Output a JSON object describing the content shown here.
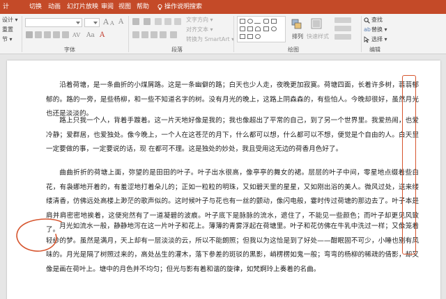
{
  "ribbon": {
    "tabs": [
      "计",
      "切换",
      "动画",
      "幻灯片放映",
      "审阅",
      "视图",
      "帮助"
    ],
    "tell_me": "操作说明搜索",
    "clipboard_items": [
      "设计 ▾",
      "重置",
      "节 ▾"
    ],
    "groups": {
      "font": "字体",
      "paragraph": "段落",
      "drawing": "绘图",
      "editing": "编辑"
    },
    "paragraph_items": [
      "文字方向 ▾",
      "对齐文本 ▾",
      "转换为 SmartArt ▾"
    ],
    "drawing_items": [
      "排列",
      "快速样式"
    ],
    "editing_items": [
      "查找",
      "替换 ▾",
      "选择 ▾"
    ],
    "glyphs": {
      "font_size_up": "A",
      "font_size_down": "A",
      "clear_format": "A",
      "char_spacing": "AV",
      "text_color": "A",
      "case": "Aa"
    }
  },
  "document": {
    "paragraphs": [
      "沿着荷塘，是一条曲折的小煤屑路。这是一条幽僻的路；白天也少人走，夜晚更加寂寞。荷塘四面，长着许多树，蓊蓊郁郁的。路的一旁，是些杨柳，和一些不知道名字的树。没有月光的晚上，这路上阴森森的，有些怕人。今晚却很好，虽然月光也还是淡淡的。",
      "路上只我一个人，背着手踱着。这一片天地好像是我的；我也像超出了平常的自己，到了另一个世界里。我爱热闹，也爱冷静；爱群居，也爱独处。像今晚上，一个人在这苍茫的月下，什么都可以想，什么都可以不想，便觉是个自由的人。白天里一定要做的事，一定要说的话，现 在都可不理。这是独处的妙处，我且受用这无边的荷香月色好了。",
      "曲曲折折的荷塘上面，弥望的是田田的叶子。叶子出水很高，像亭亭的舞女的裙。层层的叶子中间，零星地点缀着些白花，有袅娜地开着的，有羞涩地打着朵儿的；正如一粒粒的明珠，又如碧天里的星星，又如刚出浴的美人。微风过处，送来缕缕清香，仿佛远处高楼上渺茫的歌声似的。这时候叶子与花也有一丝的颤动，像闪电般，霎时传过荷塘的那边去了。叶子本是肩并肩密密地挨着，这便宛然有了一道凝碧的波痕。叶子底下是脉脉的流水，遮住了，不能见一些颜色；而叶子却更见风致了。",
      "月光如流水一般，静静地泻在这一片叶子和花上。薄薄的青雾浮起在荷塘里。叶子和花仿佛在牛乳中洗过一样；又像笼着轻纱的梦。虽然是满月，天上却有一层淡淡的云，所以不能朗照；但我以为这恰是到了好处——酣眠固不可少，小睡也别有风味的。月光是隔了树照过来的，高处丛生的灌木，落下参差的斑驳的黑影，峭楞楞如鬼一般；弯弯的杨柳的稀疏的倩影，却又像是画在荷叶上。塘中的月色并不均匀；但光与影有着和谐的旋律，如梵婀玲上奏着的名曲。"
    ]
  },
  "colors": {
    "tab_bar": "#c44a28",
    "annotation_red": "#d6542d",
    "page_bg": "#ffffff",
    "text": "#222222"
  }
}
